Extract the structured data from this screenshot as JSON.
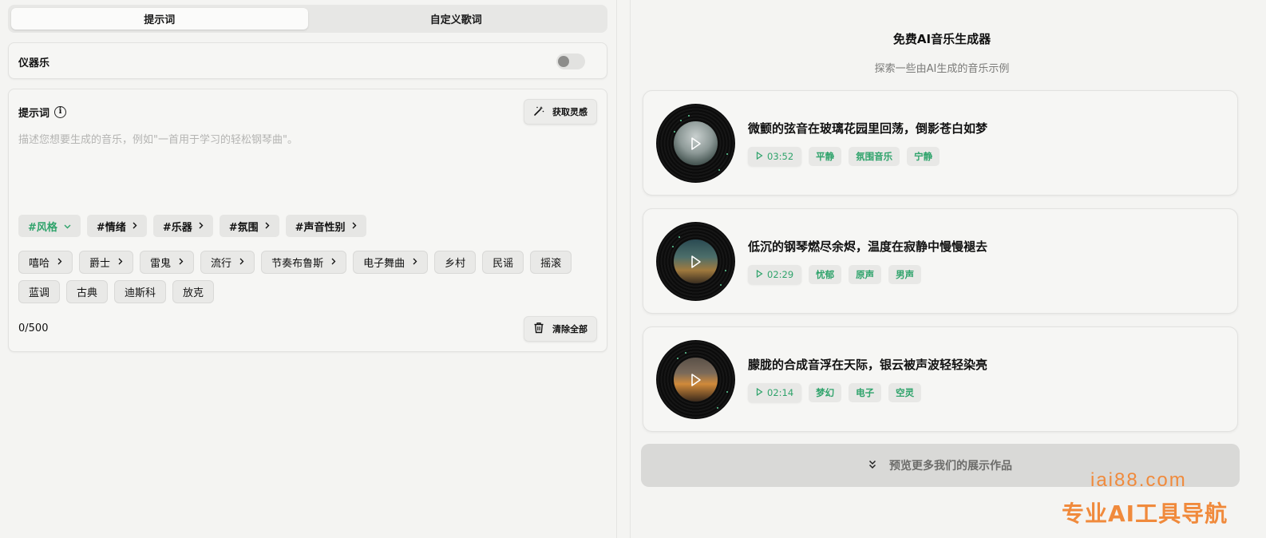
{
  "mode_tabs": [
    {
      "label": "提示词",
      "active": true
    },
    {
      "label": "自定义歌词",
      "active": false
    }
  ],
  "instrumental": {
    "label": "仪器乐",
    "enabled": false
  },
  "prompt": {
    "title": "提示词",
    "inspire_label": "获取灵感",
    "placeholder": "描述您想要生成的音乐，例如\"一首用于学习的轻松钢琴曲\"。",
    "categories": [
      {
        "label": "#风格",
        "active": true,
        "chevron": "chevron-down-icon"
      },
      {
        "label": "#情绪",
        "active": false,
        "chevron": "chevron-right-icon"
      },
      {
        "label": "#乐器",
        "active": false,
        "chevron": "chevron-right-icon"
      },
      {
        "label": "#氛围",
        "active": false,
        "chevron": "chevron-right-icon"
      },
      {
        "label": "#声音性别",
        "active": false,
        "chevron": "chevron-right-icon"
      }
    ],
    "genres": [
      {
        "label": "嘻哈",
        "has_sub": true
      },
      {
        "label": "爵士",
        "has_sub": true
      },
      {
        "label": "雷鬼",
        "has_sub": true
      },
      {
        "label": "流行",
        "has_sub": true
      },
      {
        "label": "节奏布鲁斯",
        "has_sub": true
      },
      {
        "label": "电子舞曲",
        "has_sub": true
      },
      {
        "label": "乡村",
        "has_sub": false
      },
      {
        "label": "民谣",
        "has_sub": false
      },
      {
        "label": "摇滚",
        "has_sub": false
      },
      {
        "label": "蓝调",
        "has_sub": false
      },
      {
        "label": "古典",
        "has_sub": false
      },
      {
        "label": "迪斯科",
        "has_sub": false
      },
      {
        "label": "放克",
        "has_sub": false
      }
    ],
    "counter": "0/500",
    "clear_label": "清除全部"
  },
  "showcase": {
    "title": "免费AI音乐生成器",
    "subtitle": "探索一些由AI生成的音乐示例",
    "songs": [
      {
        "title": "微颤的弦音在玻璃花园里回荡，倒影苍白如梦",
        "duration": "03:52",
        "tags": [
          "平静",
          "氛围音乐",
          "宁静"
        ]
      },
      {
        "title": "低沉的钢琴燃尽余烬，温度在寂静中慢慢褪去",
        "duration": "02:29",
        "tags": [
          "忧郁",
          "原声",
          "男声"
        ]
      },
      {
        "title": "朦胧的合成音浮在天际，银云被声波轻轻染亮",
        "duration": "02:14",
        "tags": [
          "梦幻",
          "电子",
          "空灵"
        ]
      }
    ],
    "more_label": "预览更多我们的展示作品"
  },
  "watermark": {
    "url": "iai88.com",
    "name": "专业AI工具导航"
  },
  "colors": {
    "accent_green": "#2fa36b",
    "watermark_orange": "#f08a3c"
  }
}
